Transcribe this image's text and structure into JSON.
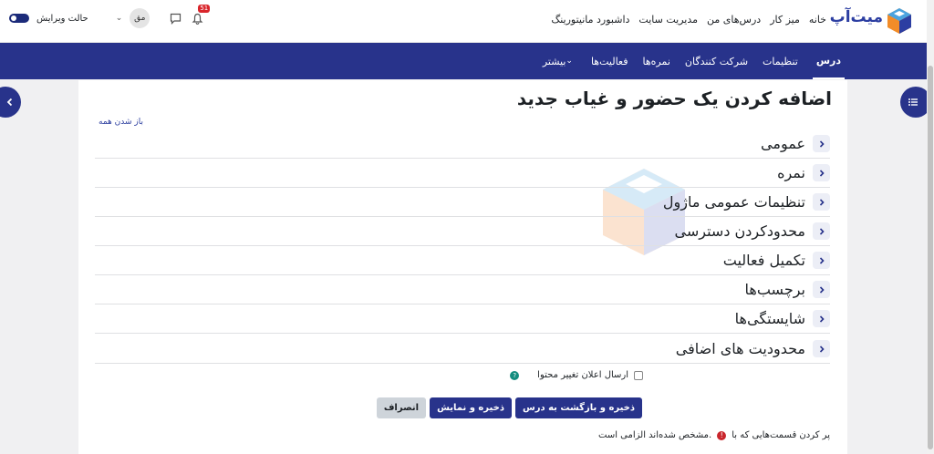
{
  "header": {
    "logo_text": "میت‌آپ",
    "nav": [
      "خانه",
      "میز کار",
      "درس‌های من",
      "مدیریت سایت",
      "داشبورد مانیتورینگ"
    ],
    "notification_count": "51",
    "avatar_initials": "مق",
    "edit_mode_label": "حالت ویرایش"
  },
  "course_nav": {
    "tabs": [
      "درس",
      "تنظیمات",
      "شرکت کنندگان",
      "نمره‌ها",
      "فعالیت‌ها",
      "بیشتر"
    ],
    "active_tab": "درس"
  },
  "page": {
    "title": "اضافه کردن یک حضور و غیاب جدید",
    "expand_all": "باز شدن همه",
    "sections": [
      "عمومی",
      "نمره",
      "تنظیمات عمومی ماژول",
      "محدودکردن دسترسی",
      "تکمیل فعالیت",
      "برچسب‌ها",
      "شایستگی‌ها",
      "محدودیت های اضافی"
    ],
    "notify_label": "ارسال اعلان تغییر محتوا",
    "buttons": {
      "save_return": "ذخیره و بازگشت به درس",
      "save_display": "ذخیره و نمایش",
      "cancel": "انصراف"
    },
    "required_prefix": "پر کردن قسمت‌هایی که با",
    "required_suffix": "مشخص شده‌اند الزامی است."
  },
  "colors": {
    "primary": "#28338b",
    "link": "#2c3e9f",
    "required": "#c9262c"
  }
}
